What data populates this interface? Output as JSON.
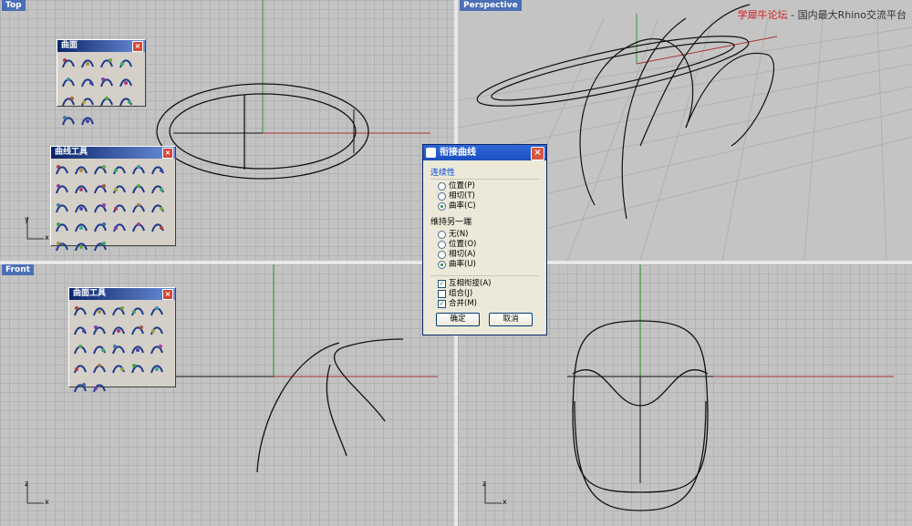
{
  "watermark": {
    "brand": "学犀牛论坛",
    "sep": " - ",
    "tagline": "国内最大Rhino交流平台"
  },
  "viewports": {
    "top": {
      "label": "Top",
      "axis_y": "y",
      "axis_x": "x"
    },
    "perspective": {
      "label": "Perspective"
    },
    "front": {
      "label": "Front",
      "axis_z": "z",
      "axis_x": "x"
    },
    "right": {
      "axis_z": "z",
      "axis_x": "x"
    }
  },
  "toolbars": {
    "surface": {
      "title": "曲面",
      "icons": [
        "surface-corner-icon",
        "surface-plane-icon",
        "sphere-icon",
        "grid-plane-icon",
        "surface-edge-icon",
        "surface-points-icon",
        "surface-shape-icon",
        "loft-icon",
        "revolve-icon",
        "rail-icon",
        "extrude-icon",
        "patch-icon",
        "network-icon",
        "box-icon"
      ]
    },
    "curve_tools": {
      "title": "曲线工具",
      "icons": [
        "curve-fillet-icon",
        "curve-chamfer-icon",
        "blend-icon",
        "curve-adjust-icon",
        "curve-match-icon",
        "curve-offset-icon",
        "curve-extend-icon",
        "curve-join-icon",
        "curve-split-icon",
        "curve-trim-icon",
        "curve-rebuild-icon",
        "curve-fit-icon",
        "curve-degree-icon",
        "curve-fair-icon",
        "curve-smooth-icon",
        "curve-points-icon",
        "curve-weight-icon",
        "curve-kink-icon",
        "curve-refit-icon",
        "curve-insert-icon",
        "curve-remove-icon",
        "curve-handle-icon",
        "curve-seam-icon",
        "curve-direction-icon",
        "curve-analyze-icon",
        "curve-misc-icon",
        "curve-select-icon"
      ]
    },
    "surface_tools": {
      "title": "曲面工具",
      "icons": [
        "srf-fillet-icon",
        "srf-chamfer-icon",
        "srf-blend-icon",
        "srf-offset-icon",
        "srf-extend-icon",
        "srf-match-icon",
        "srf-merge-icon",
        "srf-join-icon",
        "srf-split-icon",
        "srf-trim-icon",
        "srf-rebuild-icon",
        "srf-fit-icon",
        "srf-degree-icon",
        "srf-edge-icon",
        "srf-shrink-icon",
        "srf-untrim-icon",
        "srf-points-icon",
        "srf-smooth-icon",
        "srf-adjust-icon",
        "srf-analyze-icon",
        "srf-tools-icon",
        "srf-extra-icon"
      ]
    }
  },
  "dialog": {
    "title": "衔接曲线",
    "continuity_label": "连续性",
    "continuity_options": [
      "位置(P)",
      "相切(T)",
      "曲率(C)"
    ],
    "continuity_selected": 2,
    "maintain_label": "维持另一端",
    "maintain_options": [
      "无(N)",
      "位置(O)",
      "相切(A)",
      "曲率(U)"
    ],
    "maintain_selected": 3,
    "checkboxes": [
      {
        "label": "互相衔接(A)",
        "checked": true
      },
      {
        "label": "组合(J)",
        "checked": false
      },
      {
        "label": "合并(M)",
        "checked": true
      }
    ],
    "ok_label": "确定",
    "cancel_label": "取消"
  },
  "colors": {
    "x_axis": "#b03030",
    "y_axis": "#2a9a2a",
    "curve": "#111111",
    "accent": "#4b6fb6"
  }
}
